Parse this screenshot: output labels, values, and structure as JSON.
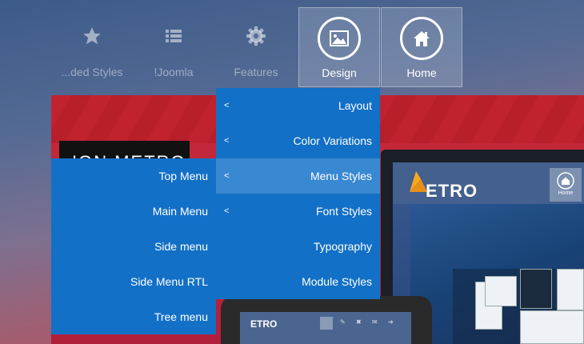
{
  "nav": {
    "items": [
      {
        "label": "...ded Styles",
        "icon": "star-icon"
      },
      {
        "label": "!Joomla",
        "icon": "list-icon"
      },
      {
        "label": "Features",
        "icon": "gear-icon"
      },
      {
        "label": "Design",
        "icon": "image-icon"
      },
      {
        "label": "Home",
        "icon": "home-icon"
      }
    ]
  },
  "hero": {
    "logo_text": "ION METRO"
  },
  "preview": {
    "logo_text": "ETRO",
    "home_label": "Home",
    "tablet_logo": "ETRO"
  },
  "design_menu": {
    "items": [
      {
        "label": "Layout",
        "submenu": true
      },
      {
        "label": "Color Variations",
        "submenu": true
      },
      {
        "label": "Menu Styles",
        "submenu": true,
        "highlighted": true
      },
      {
        "label": "Font Styles",
        "submenu": true
      },
      {
        "label": "Typography",
        "submenu": false
      },
      {
        "label": "Module Styles",
        "submenu": false
      }
    ]
  },
  "menu_styles_submenu": {
    "items": [
      {
        "label": "Top Menu"
      },
      {
        "label": "Main Menu"
      },
      {
        "label": "Side menu"
      },
      {
        "label": "Side Menu RTL"
      },
      {
        "label": "Tree menu"
      }
    ]
  },
  "colors": {
    "menu_bg": "#1270c6",
    "menu_highlight": "#3889d2",
    "hero_red": "#c0232f"
  }
}
